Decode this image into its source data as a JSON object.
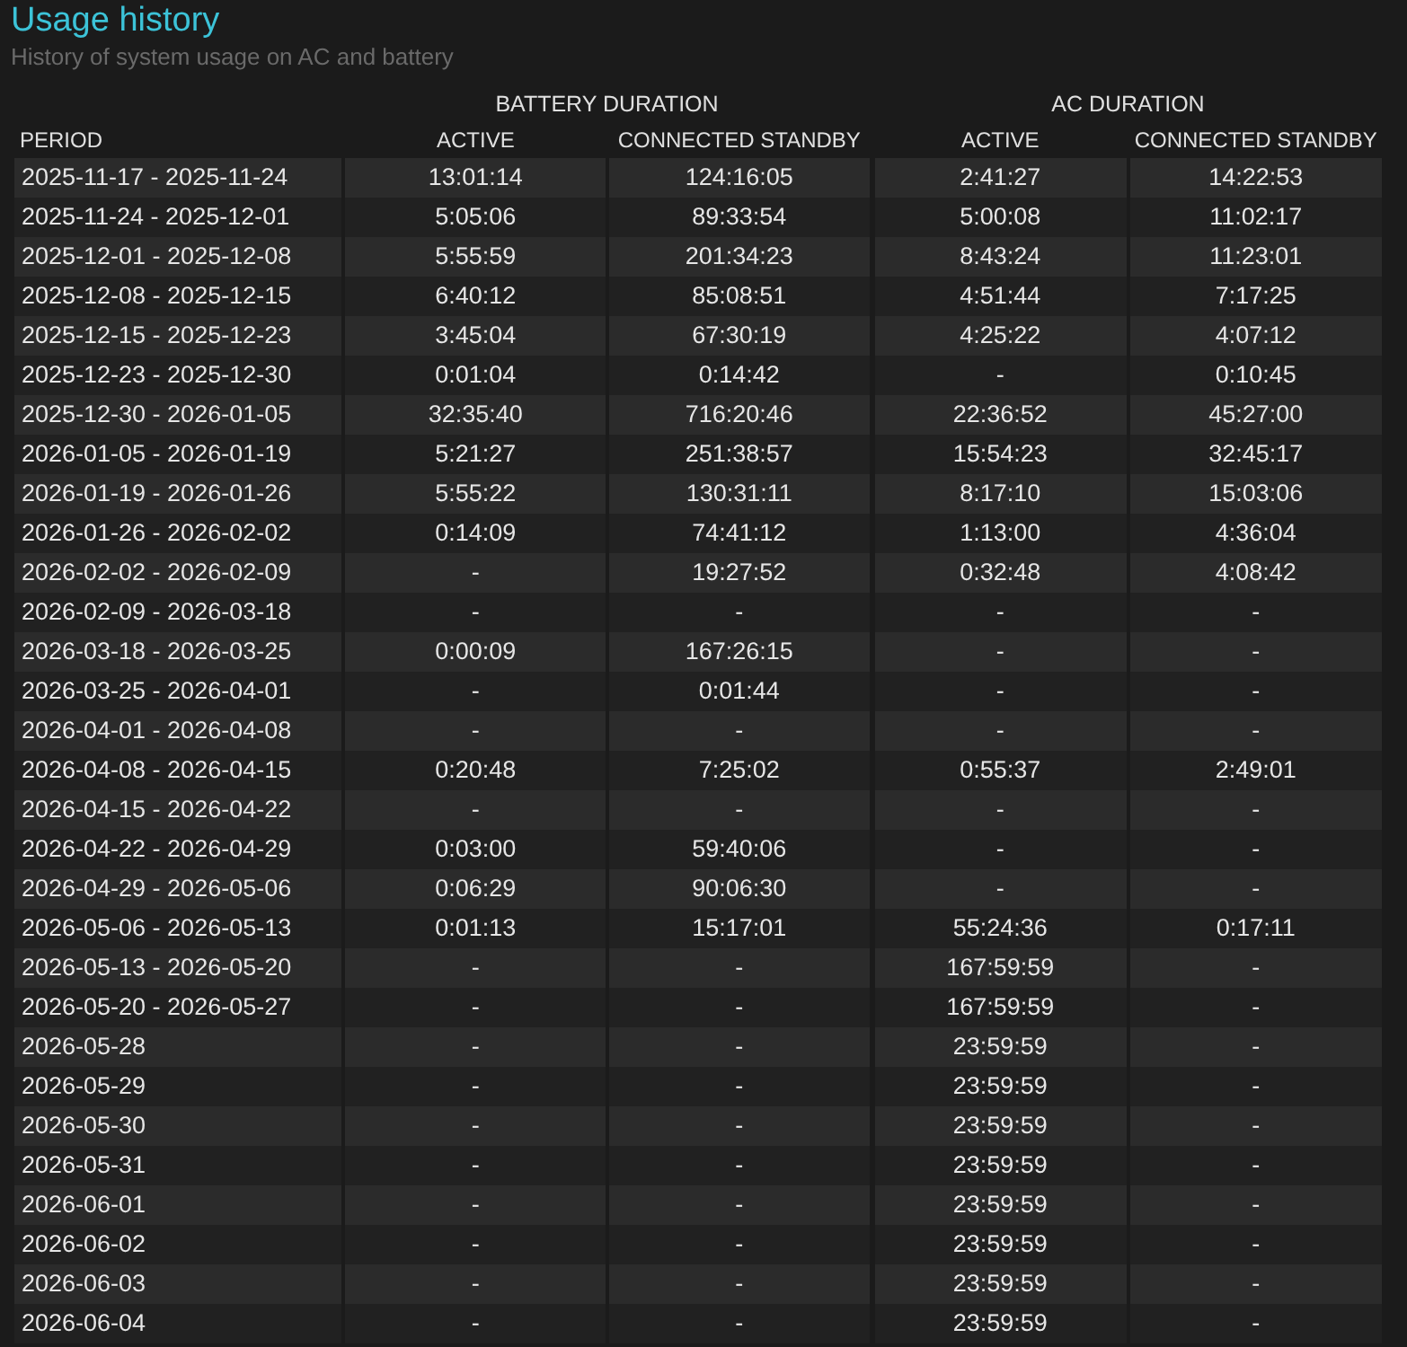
{
  "title": "Usage history",
  "subtitle": "History of system usage on AC and battery",
  "table": {
    "groups": [
      "BATTERY DURATION",
      "AC DURATION"
    ],
    "columns": [
      "PERIOD",
      "ACTIVE",
      "CONNECTED STANDBY",
      "ACTIVE",
      "CONNECTED STANDBY"
    ],
    "rows": [
      [
        "2025-11-17 - 2025-11-24",
        "13:01:14",
        "124:16:05",
        "2:41:27",
        "14:22:53"
      ],
      [
        "2025-11-24 - 2025-12-01",
        "5:05:06",
        "89:33:54",
        "5:00:08",
        "11:02:17"
      ],
      [
        "2025-12-01 - 2025-12-08",
        "5:55:59",
        "201:34:23",
        "8:43:24",
        "11:23:01"
      ],
      [
        "2025-12-08 - 2025-12-15",
        "6:40:12",
        "85:08:51",
        "4:51:44",
        "7:17:25"
      ],
      [
        "2025-12-15 - 2025-12-23",
        "3:45:04",
        "67:30:19",
        "4:25:22",
        "4:07:12"
      ],
      [
        "2025-12-23 - 2025-12-30",
        "0:01:04",
        "0:14:42",
        "-",
        "0:10:45"
      ],
      [
        "2025-12-30 - 2026-01-05",
        "32:35:40",
        "716:20:46",
        "22:36:52",
        "45:27:00"
      ],
      [
        "2026-01-05 - 2026-01-19",
        "5:21:27",
        "251:38:57",
        "15:54:23",
        "32:45:17"
      ],
      [
        "2026-01-19 - 2026-01-26",
        "5:55:22",
        "130:31:11",
        "8:17:10",
        "15:03:06"
      ],
      [
        "2026-01-26 - 2026-02-02",
        "0:14:09",
        "74:41:12",
        "1:13:00",
        "4:36:04"
      ],
      [
        "2026-02-02 - 2026-02-09",
        "-",
        "19:27:52",
        "0:32:48",
        "4:08:42"
      ],
      [
        "2026-02-09 - 2026-03-18",
        "-",
        "-",
        "-",
        "-"
      ],
      [
        "2026-03-18 - 2026-03-25",
        "0:00:09",
        "167:26:15",
        "-",
        "-"
      ],
      [
        "2026-03-25 - 2026-04-01",
        "-",
        "0:01:44",
        "-",
        "-"
      ],
      [
        "2026-04-01 - 2026-04-08",
        "-",
        "-",
        "-",
        "-"
      ],
      [
        "2026-04-08 - 2026-04-15",
        "0:20:48",
        "7:25:02",
        "0:55:37",
        "2:49:01"
      ],
      [
        "2026-04-15 - 2026-04-22",
        "-",
        "-",
        "-",
        "-"
      ],
      [
        "2026-04-22 - 2026-04-29",
        "0:03:00",
        "59:40:06",
        "-",
        "-"
      ],
      [
        "2026-04-29 - 2026-05-06",
        "0:06:29",
        "90:06:30",
        "-",
        "-"
      ],
      [
        "2026-05-06 - 2026-05-13",
        "0:01:13",
        "15:17:01",
        "55:24:36",
        "0:17:11"
      ],
      [
        "2026-05-13 - 2026-05-20",
        "-",
        "-",
        "167:59:59",
        "-"
      ],
      [
        "2026-05-20 - 2026-05-27",
        "-",
        "-",
        "167:59:59",
        "-"
      ],
      [
        "2026-05-28",
        "-",
        "-",
        "23:59:59",
        "-"
      ],
      [
        "2026-05-29",
        "-",
        "-",
        "23:59:59",
        "-"
      ],
      [
        "2026-05-30",
        "-",
        "-",
        "23:59:59",
        "-"
      ],
      [
        "2026-05-31",
        "-",
        "-",
        "23:59:59",
        "-"
      ],
      [
        "2026-06-01",
        "-",
        "-",
        "23:59:59",
        "-"
      ],
      [
        "2026-06-02",
        "-",
        "-",
        "23:59:59",
        "-"
      ],
      [
        "2026-06-03",
        "-",
        "-",
        "23:59:59",
        "-"
      ],
      [
        "2026-06-04",
        "-",
        "-",
        "23:59:59",
        "-"
      ]
    ]
  }
}
